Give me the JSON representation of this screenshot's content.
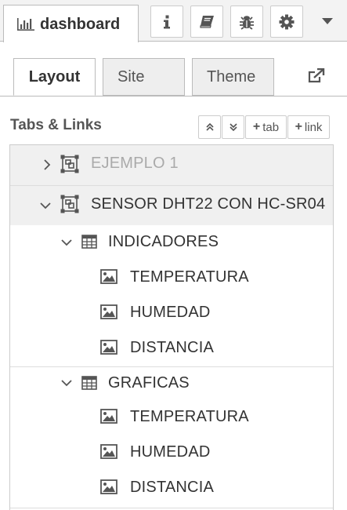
{
  "header": {
    "dashboard_tab_label": "dashboard",
    "buttons": [
      {
        "name": "info-button",
        "icon": "info-icon"
      },
      {
        "name": "book-button",
        "icon": "book-icon"
      },
      {
        "name": "debug-button",
        "icon": "bug-icon"
      },
      {
        "name": "settings-button",
        "icon": "gear-icon"
      }
    ],
    "caret_icon": "caret-down-icon"
  },
  "subtabs": [
    {
      "label": "Layout",
      "active": true
    },
    {
      "label": "Site",
      "active": false
    },
    {
      "label": "Theme",
      "active": false
    }
  ],
  "section": {
    "title": "Tabs & Links",
    "btn_tab": "tab",
    "btn_link": "link"
  },
  "tree": {
    "tabs": [
      {
        "label": "EJEMPLO 1",
        "expanded": false,
        "disabled": true
      },
      {
        "label": "SENSOR DHT22 CON HC-SR04",
        "expanded": true,
        "groups": [
          {
            "label": "INDICADORES",
            "items": [
              "TEMPERATURA",
              "HUMEDAD",
              "DISTANCIA"
            ]
          },
          {
            "label": "GRAFICAS",
            "items": [
              "TEMPERATURA",
              "HUMEDAD",
              "DISTANCIA"
            ]
          }
        ]
      }
    ]
  },
  "colors": {
    "accent_text": "#333333",
    "disabled_text": "#aaaaaa",
    "border": "#bbbbbb"
  }
}
